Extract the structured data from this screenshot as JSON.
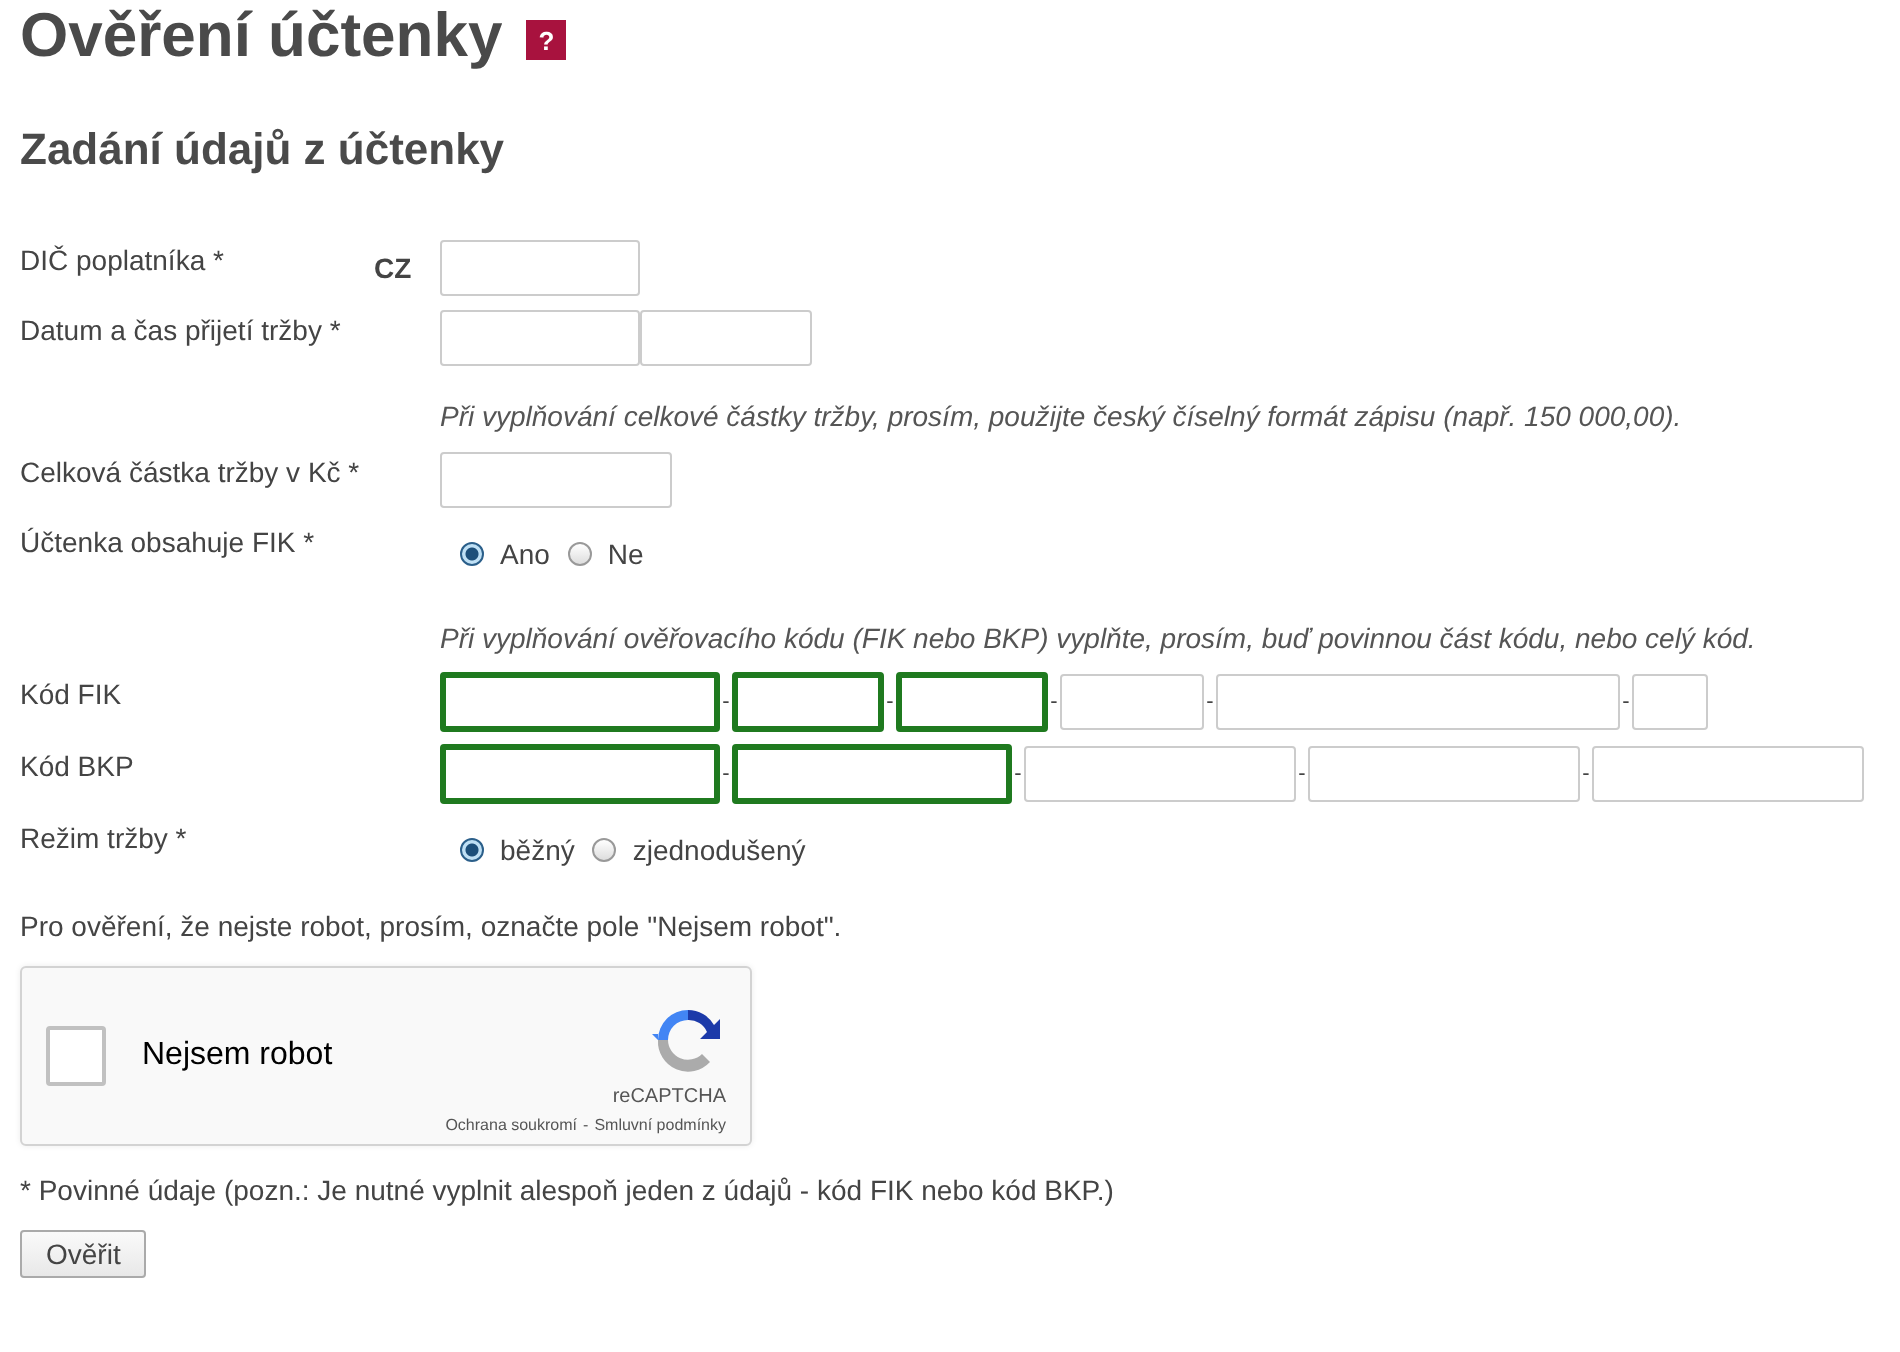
{
  "page": {
    "title": "Ověření účtenky",
    "help_badge": "?"
  },
  "section": {
    "title": "Zadání údajů z účtenky"
  },
  "fields": [
    {
      "kind": "prefixed",
      "label": "DIČ poplatníka *",
      "prefix": "CZ"
    },
    {
      "kind": "datetime",
      "label": "Datum a čas přijetí tržby *"
    },
    {
      "kind": "hint",
      "text": "Při vyplňování celkové částky tržby, prosím, použijte český číselný formát zápisu (např. 150 000,00)."
    },
    {
      "kind": "text",
      "label": "Celková částka tržby v Kč *"
    },
    {
      "kind": "radio",
      "label": "Účtenka obsahuje FIK *",
      "options": [
        {
          "label": "Ano",
          "selected": true
        },
        {
          "label": "Ne",
          "selected": false
        }
      ]
    },
    {
      "kind": "hint",
      "text": "Při vyplňování ověřovacího kódu (FIK nebo BKP) vyplňte, prosím, buď povinnou část kódu, nebo celý kód."
    },
    {
      "kind": "code",
      "label": "Kód FIK",
      "segments": [
        {
          "required": true
        },
        {
          "separator": "-",
          "required": true
        },
        {
          "separator": "-",
          "required": true
        },
        {
          "separator": "-",
          "required": false
        },
        {
          "separator": "-",
          "required": false
        },
        {
          "separator": "-",
          "required": false
        }
      ]
    },
    {
      "kind": "code",
      "label": "Kód BKP",
      "segments": [
        {
          "required": true
        },
        {
          "separator": "-",
          "required": true
        },
        {
          "separator": "-",
          "required": false
        },
        {
          "separator": "-",
          "required": false
        },
        {
          "separator": "-",
          "required": false
        }
      ]
    },
    {
      "kind": "radio",
      "label": "Režim tržby *",
      "options": [
        {
          "label": "běžný",
          "selected": true
        },
        {
          "label": "zjednodušený",
          "selected": false
        }
      ]
    }
  ],
  "captcha": {
    "instruction": "Pro ověření, že nejste robot, prosím, označte pole \"Nejsem robot\".",
    "label": "Nejsem robot",
    "checked": false,
    "brand": "reCAPTCHA",
    "privacy_link": "Ochrana soukromí",
    "link_separator": "-",
    "terms_link": "Smluvní podmínky"
  },
  "note": "* Povinné údaje (pozn.: Je nutné vyplnit alespoň jeden z údajů - kód FIK nebo kód BKP.)",
  "submit": "Ověřit"
}
